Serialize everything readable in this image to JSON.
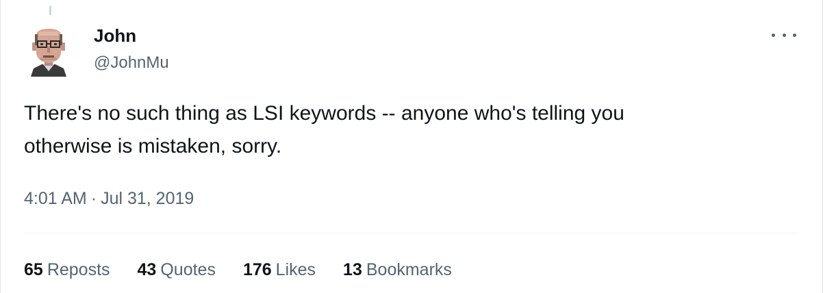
{
  "author": {
    "name": "John",
    "handle": "@JohnMu",
    "avatar_icon": "pixel-art-portrait-avatar"
  },
  "tweet": {
    "text": "There's no such thing as LSI keywords -- anyone who's telling you\notherwise is mistaken, sorry.",
    "time": "4:01 AM",
    "separator": "·",
    "date": "Jul 31, 2019"
  },
  "stats": [
    {
      "count": "65",
      "label": "Reposts"
    },
    {
      "count": "43",
      "label": "Quotes"
    },
    {
      "count": "176",
      "label": "Likes"
    },
    {
      "count": "13",
      "label": "Bookmarks"
    }
  ],
  "menu_icon": "more-horizontal-icon",
  "colors": {
    "text": "#0f1419",
    "secondary": "#536471",
    "divider": "#eff3f4"
  }
}
